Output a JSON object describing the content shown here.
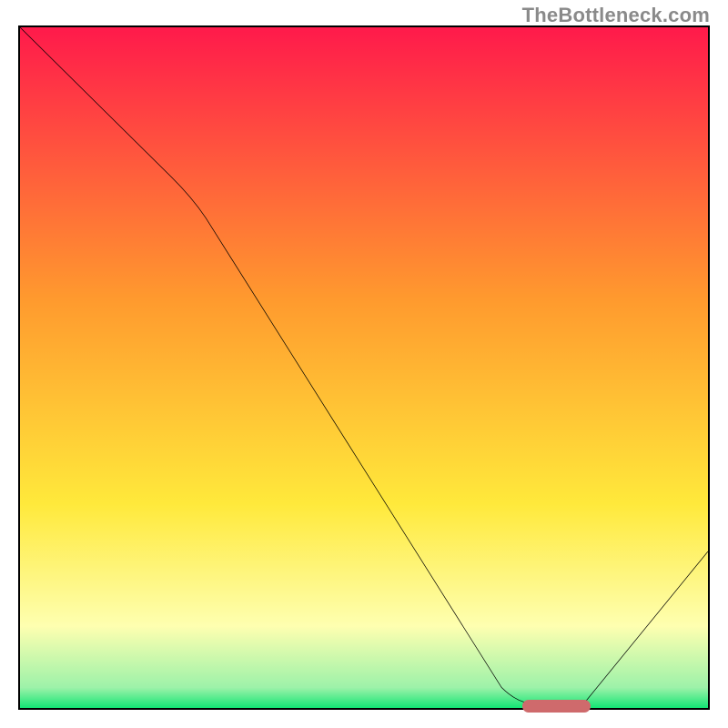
{
  "watermark": "TheBottleneck.com",
  "colors": {
    "red": "#ff1a4b",
    "orange": "#ff9a2e",
    "yellow": "#ffe93b",
    "paleYellow": "#feffb0",
    "green": "#12e574",
    "curve": "#000000",
    "marker": "#cf6a6c",
    "frame": "#000000"
  },
  "chart_data": {
    "type": "line",
    "title": "",
    "xlabel": "",
    "ylabel": "",
    "xlim": [
      0,
      100
    ],
    "ylim": [
      0,
      100
    ],
    "x": [
      0,
      22,
      70,
      74,
      82,
      100
    ],
    "values": [
      100,
      78,
      3,
      0.7,
      0.7,
      23
    ],
    "marker": {
      "x_start": 74,
      "x_end": 82,
      "y": 0.7
    },
    "gradient_stops": [
      {
        "pos": 0,
        "color": "#ff1a4b"
      },
      {
        "pos": 40,
        "color": "#ff9a2e"
      },
      {
        "pos": 70,
        "color": "#ffe93b"
      },
      {
        "pos": 88,
        "color": "#feffb0"
      },
      {
        "pos": 100,
        "color": "#12e574"
      }
    ]
  }
}
